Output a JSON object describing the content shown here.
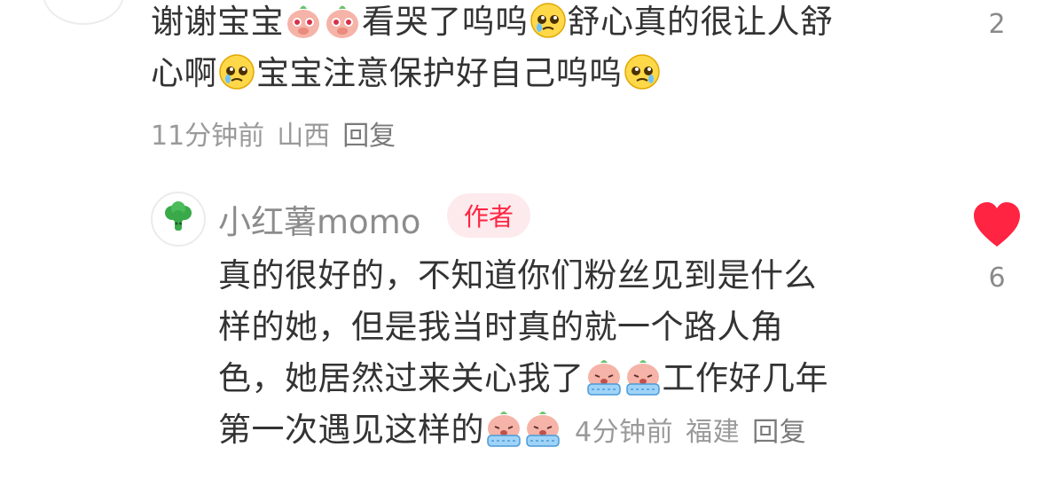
{
  "comment_top": {
    "segments": [
      "谢谢宝宝",
      "看哭了呜呜",
      "舒心真的很让人舒",
      "心啊",
      "宝宝注意保护好自己呜呜"
    ],
    "time": "11分钟前",
    "location": "山西",
    "reply_label": "回复",
    "like_count": "2"
  },
  "reply": {
    "avatar_icon": "broccoli-icon",
    "username": "小红薯momo",
    "author_badge": "作者",
    "lines": [
      "真的很好的，不知道你们粉丝见到是什么",
      "样的她，但是我当时真的就一个路人角",
      "色，她居然过来关心我了",
      "工作好几年",
      "第一次遇见这样的"
    ],
    "time": "4分钟前",
    "location": "福建",
    "reply_label": "回复",
    "like_count": "6",
    "liked": true
  },
  "colors": {
    "accent": "#ff2442",
    "text": "#333333",
    "meta": "#9a9a9a"
  }
}
